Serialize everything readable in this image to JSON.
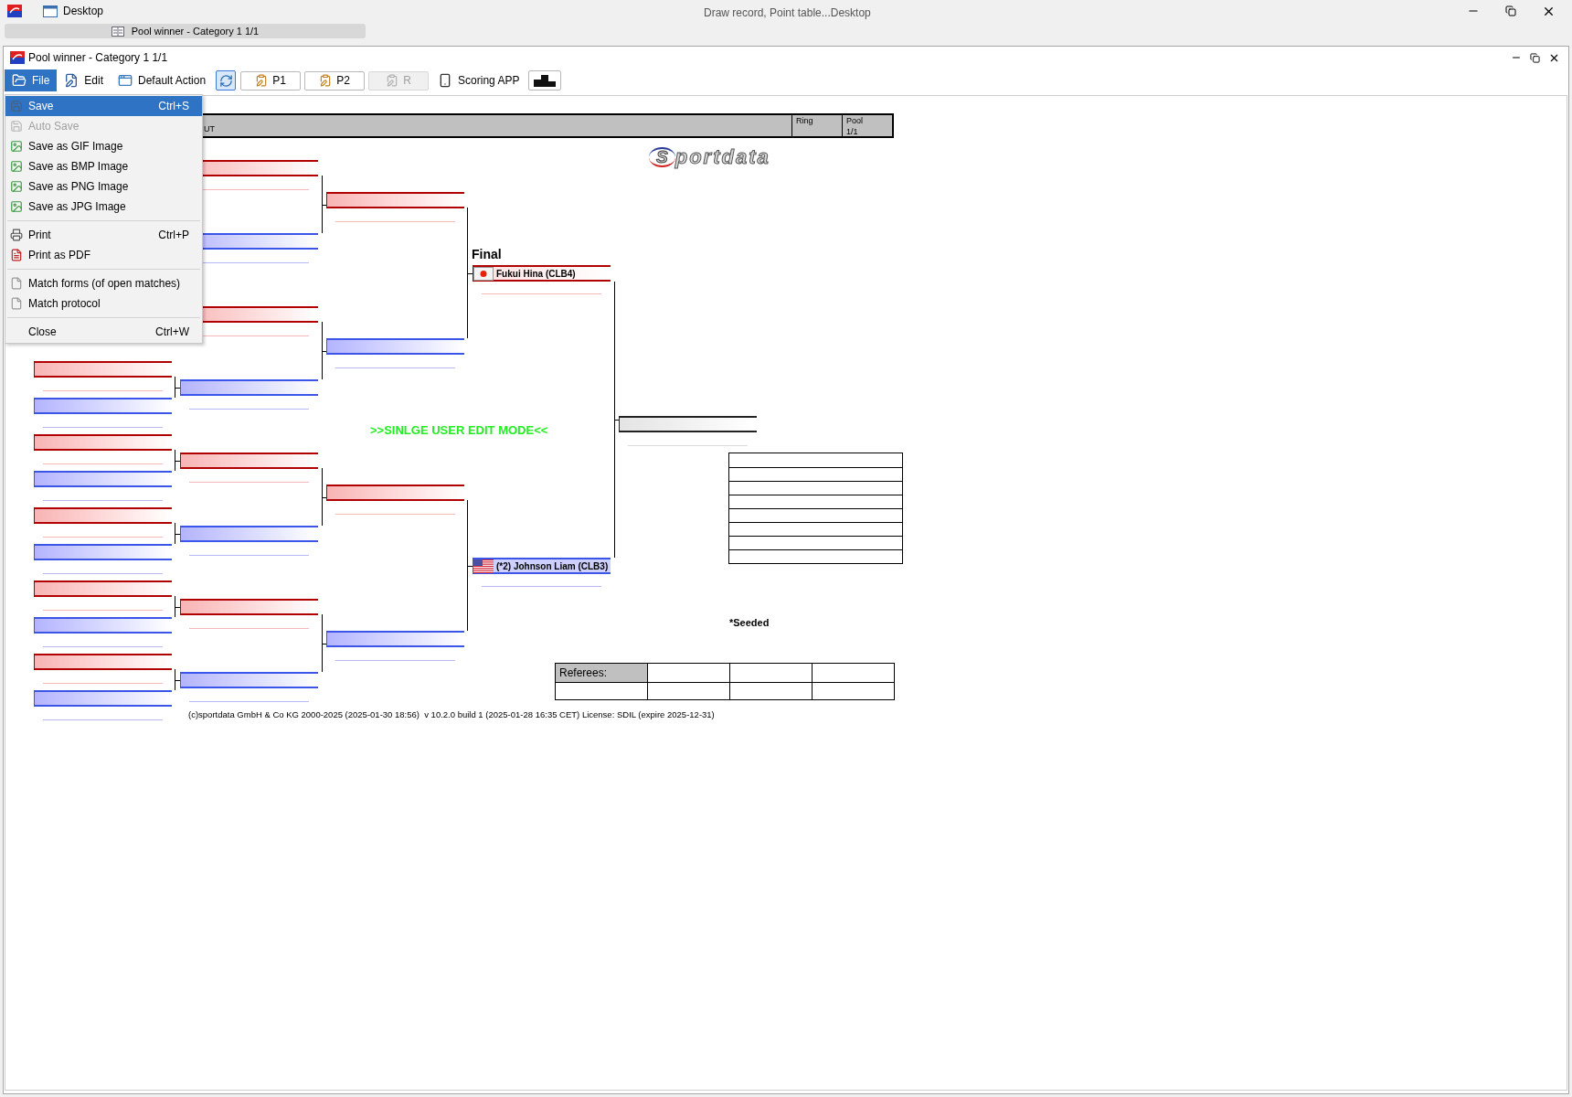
{
  "desktop": {
    "title": "Desktop",
    "caption": "Draw record, Point table...Desktop"
  },
  "taskbar_tab": {
    "label": "Pool winner - Category 1 1/1"
  },
  "window": {
    "title": "Pool winner - Category 1 1/1"
  },
  "toolbar": [
    {
      "kind": "file",
      "label": "File",
      "selected": true
    },
    {
      "kind": "edit",
      "label": "Edit",
      "selected": false
    },
    {
      "kind": "action",
      "label": "Default Action",
      "selected": false
    },
    {
      "kind": "toggle",
      "selected": true
    },
    {
      "kind": "panel",
      "label": "P1",
      "disabled": false
    },
    {
      "kind": "panel",
      "label": "P2",
      "disabled": false
    },
    {
      "kind": "panel",
      "label": "R",
      "disabled": true
    },
    {
      "kind": "phone",
      "label": "Scoring APP",
      "selected": false
    },
    {
      "kind": "podium",
      "selected": false
    }
  ],
  "file_menu": {
    "groups": [
      [
        {
          "kind": "save",
          "label": "Save",
          "shortcut": "Ctrl+S",
          "selected": true,
          "disabled": false
        },
        {
          "kind": "save",
          "label": "Auto Save",
          "selected": false,
          "disabled": true
        },
        {
          "kind": "image",
          "label": "Save as GIF Image",
          "selected": false,
          "disabled": false
        },
        {
          "kind": "image",
          "label": "Save as BMP Image",
          "selected": false,
          "disabled": false
        },
        {
          "kind": "image",
          "label": "Save as PNG Image",
          "selected": false,
          "disabled": false
        },
        {
          "kind": "image",
          "label": "Save as JPG Image",
          "selected": false,
          "disabled": false
        }
      ],
      [
        {
          "kind": "print",
          "label": "Print",
          "shortcut": "Ctrl+P",
          "selected": false,
          "disabled": false
        },
        {
          "kind": "pdf",
          "label": "Print as PDF",
          "selected": false,
          "disabled": false
        }
      ],
      [
        {
          "kind": "document",
          "label": "Match forms (of open matches)",
          "selected": false,
          "disabled": false
        },
        {
          "kind": "document",
          "label": "Match protocol",
          "selected": false,
          "disabled": false
        }
      ],
      [
        {
          "kind": "plain",
          "label": "Close",
          "shortcut": "Ctrl+W",
          "selected": false,
          "disabled": false
        }
      ]
    ]
  },
  "header": {
    "title_fragment": "UT",
    "ring_label": "Ring",
    "pool_label": "Pool",
    "pool_value": "1/1"
  },
  "logo": {
    "initial": "S",
    "rest": "portdata"
  },
  "bracket": {
    "final_label": "Final",
    "finalists": [
      {
        "name": "Fukui Hina (CLB4)",
        "color": "#b00000",
        "kind": "japan"
      },
      {
        "name": "(*2) Johnson Liam (CLB3)",
        "color": "#3a55e8",
        "kind": "usa"
      }
    ]
  },
  "mode_banner": ">>SINLGE USER EDIT MODE<<",
  "seeded_note": "*Seeded",
  "referees": {
    "label": "Referees:"
  },
  "footer": "(c)sportdata GmbH & Co KG 2000-2025 (2025-01-30 18:56)  v 10.2.0 build 1 (2025-01-28 16:35 CET) License: SDIL (expire 2025-12-31)"
}
